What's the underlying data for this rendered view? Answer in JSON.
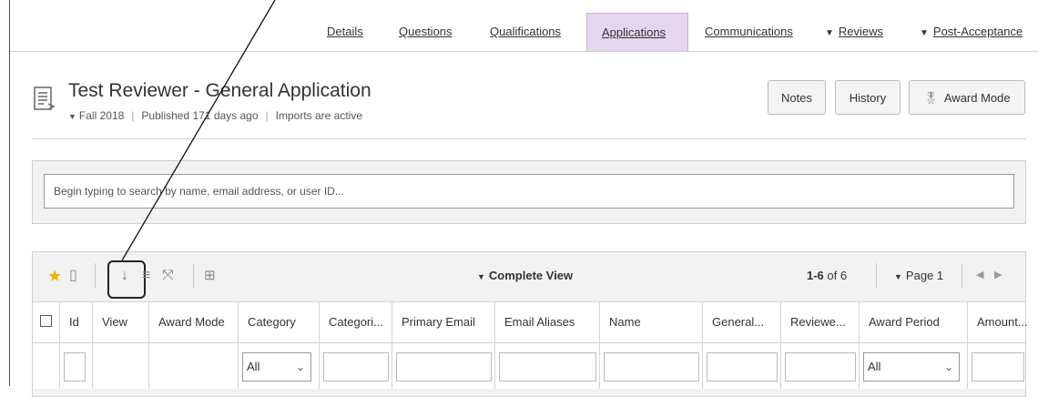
{
  "tabs": {
    "details": "Details",
    "questions": "Questions",
    "qualifications": "Qualifications",
    "applications": "Applications",
    "communications": "Communications",
    "reviews": "Reviews",
    "post_acceptance": "Post-Acceptance"
  },
  "header": {
    "title": "Test Reviewer - General Application",
    "term": "Fall 2018",
    "published": "Published 171 days ago",
    "imports": "Imports are active",
    "notes_btn": "Notes",
    "history_btn": "History",
    "award_mode_btn": "Award Mode"
  },
  "search": {
    "placeholder": "Begin typing to search by name, email address, or user ID..."
  },
  "grid": {
    "view_name": "Complete View",
    "pager_range": "1-6",
    "pager_total": "of 6",
    "page_label": "Page 1",
    "columns": [
      "Id",
      "View",
      "Award Mode",
      "Category",
      "Categori...",
      "Primary Email",
      "Email Aliases",
      "Name",
      "General...",
      "Reviewe...",
      "Award Period",
      "Amount..."
    ],
    "filter_all_category": "All",
    "filter_all_award_period": "All"
  },
  "colors": {
    "active_tab": "#e4d6ee",
    "star": "#f0b400",
    "annotation": "#111111"
  }
}
